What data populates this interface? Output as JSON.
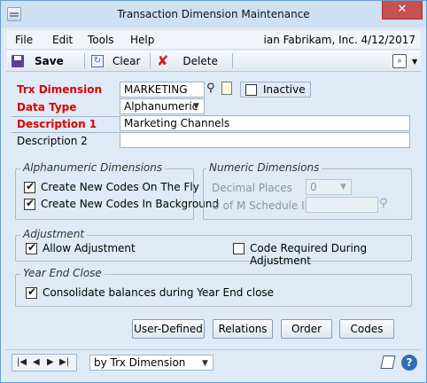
{
  "window": {
    "title": "Transaction Dimension Maintenance",
    "close_label": "✕"
  },
  "menu": {
    "items": [
      "File",
      "Edit",
      "Tools",
      "Help"
    ],
    "user": "ian",
    "company": "Fabrikam, Inc.",
    "date": "4/12/2017"
  },
  "toolbar": {
    "save_label": "Save",
    "clear_label": "Clear",
    "delete_label": "Delete"
  },
  "form": {
    "trx_dimension_label": "Trx Dimension",
    "trx_dimension_value": "MARKETING",
    "inactive_label": "Inactive",
    "inactive_checked": false,
    "data_type_label": "Data Type",
    "data_type_value": "Alphanumeric",
    "description1_label": "Description 1",
    "description1_value": "Marketing Channels",
    "description2_label": "Description 2",
    "description2_value": ""
  },
  "alphanumeric_group": {
    "title": "Alphanumeric Dimensions",
    "create_on_fly_label": "Create New Codes On The Fly",
    "create_on_fly_checked": true,
    "create_in_background_label": "Create New Codes In Background",
    "create_in_background_checked": true
  },
  "numeric_group": {
    "title": "Numeric Dimensions",
    "decimal_places_label": "Decimal Places",
    "decimal_places_value": "0",
    "uom_schedule_label": "U of M Schedule ID",
    "uom_schedule_value": ""
  },
  "adjustment_group": {
    "title": "Adjustment",
    "allow_adjustment_label": "Allow Adjustment",
    "allow_adjustment_checked": true,
    "code_required_label": "Code Required During Adjustment",
    "code_required_checked": false
  },
  "year_end_group": {
    "title": "Year End Close",
    "consolidate_label": "Consolidate balances during Year End close",
    "consolidate_checked": true
  },
  "buttons": {
    "user_defined": "User-Defined",
    "relations": "Relations",
    "order": "Order",
    "codes": "Codes"
  },
  "statusbar": {
    "sort_by_value": "by Trx Dimension"
  }
}
